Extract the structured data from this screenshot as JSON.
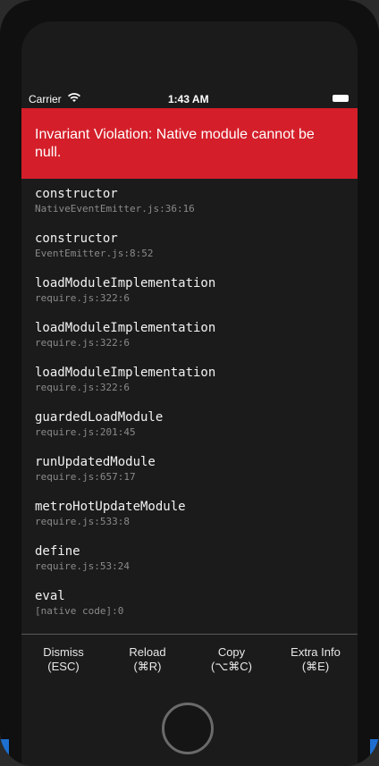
{
  "status_bar": {
    "carrier": "Carrier",
    "wifi_icon": "wifi-icon",
    "time": "1:43 AM",
    "battery_icon": "battery-icon"
  },
  "error": {
    "message": "Invariant Violation: Native module cannot be null.",
    "banner_color": "#d41f2a"
  },
  "stack": [
    {
      "method": "constructor",
      "location": "NativeEventEmitter.js:36:16"
    },
    {
      "method": "constructor",
      "location": "EventEmitter.js:8:52"
    },
    {
      "method": "loadModuleImplementation",
      "location": "require.js:322:6"
    },
    {
      "method": "loadModuleImplementation",
      "location": "require.js:322:6"
    },
    {
      "method": "loadModuleImplementation",
      "location": "require.js:322:6"
    },
    {
      "method": "guardedLoadModule",
      "location": "require.js:201:45"
    },
    {
      "method": "runUpdatedModule",
      "location": "require.js:657:17"
    },
    {
      "method": "metroHotUpdateModule",
      "location": "require.js:533:8"
    },
    {
      "method": "define",
      "location": "require.js:53:24"
    },
    {
      "method": "eval",
      "location": "[native code]:0"
    }
  ],
  "actions": {
    "dismiss": {
      "label": "Dismiss",
      "shortcut": "(ESC)"
    },
    "reload": {
      "label": "Reload",
      "shortcut": "(⌘R)"
    },
    "copy": {
      "label": "Copy",
      "shortcut": "(⌥⌘C)"
    },
    "extra_info": {
      "label": "Extra Info",
      "shortcut": "(⌘E)"
    }
  },
  "home_button_icon": "home-button-icon"
}
